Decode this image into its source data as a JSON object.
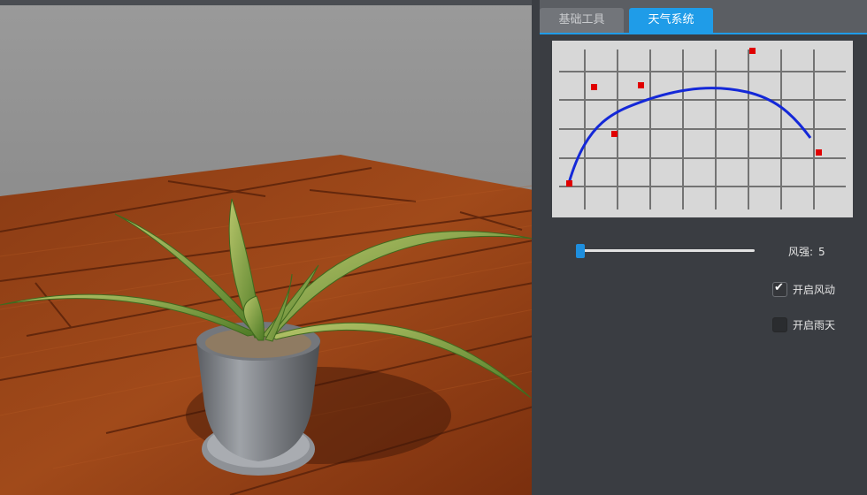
{
  "tabs": [
    {
      "label": "基础工具",
      "active": false
    },
    {
      "label": "天气系统",
      "active": true
    }
  ],
  "colors": {
    "tab_active": "#1f9ce8",
    "curve_line": "#1428d8",
    "control_point": "#e00000",
    "panel_bg": "#3a3d42"
  },
  "wind": {
    "label": "风强:",
    "value": "5",
    "slider_fraction": 0.0
  },
  "options": {
    "enable_wind": {
      "label": "开启风动",
      "checked": true
    },
    "enable_rain": {
      "label": "开启雨天",
      "checked": false
    }
  },
  "viewport": {
    "scene": "potted-spider-plant-on-wooden-floor"
  }
}
